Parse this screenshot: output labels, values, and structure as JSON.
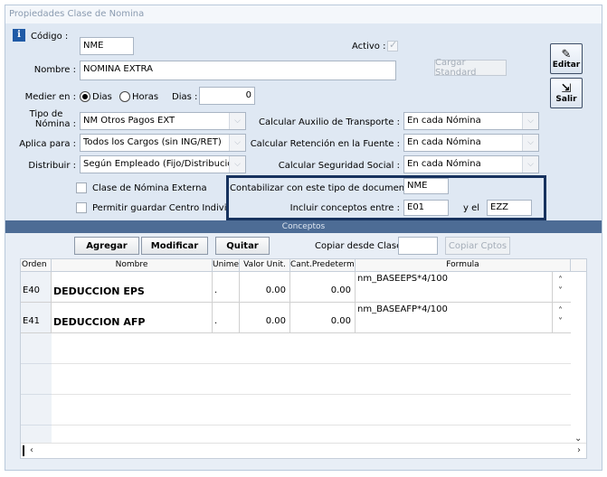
{
  "window": {
    "title": "Propiedades Clase de Nomina"
  },
  "form": {
    "codigo_label": "Código :",
    "codigo_value": "NME",
    "activo_label": "Activo :",
    "nombre_label": "Nombre :",
    "nombre_value": "NOMINA EXTRA",
    "cargar_standard": "Cargar Standard",
    "medier_label": "Medier en :",
    "radio_dias": "Dias",
    "radio_horas": "Horas",
    "dias_label": "Dias :",
    "dias_value": "0",
    "tipo_nomina_label_1": "Tipo de",
    "tipo_nomina_label_2": "Nómina :",
    "tipo_nomina_value": "NM Otros Pagos EXT",
    "aplica_label": "Aplica para :",
    "aplica_value": "Todos los Cargos (sin ING/RET)",
    "distribuir_label": "Distribuir :",
    "distribuir_value": "Según Empleado (Fijo/Distribución)",
    "auxilio_label": "Calcular Auxilio de Transporte :",
    "auxilio_value": "En cada Nómina",
    "retencion_label": "Calcular Retención en la Fuente :",
    "retencion_value": "En cada Nómina",
    "seguridad_label": "Calcular Seguridad Social :",
    "seguridad_value": "En cada Nómina",
    "externa_label": "Clase de Nómina Externa",
    "centro_label": "Permitir guardar Centro Individual",
    "contabilizar_label": "Contabilizar con este tipo de documento :",
    "contabilizar_value": "NME",
    "incluir_label": "Incluir conceptos entre :",
    "incluir_from": "E01",
    "yel_label": "y el",
    "incluir_to": "EZZ"
  },
  "side": {
    "editar": "Editar",
    "salir": "Salir"
  },
  "conceptos": {
    "section_title": "Conceptos",
    "agregar": "Agregar",
    "modificar": "Modificar",
    "quitar": "Quitar",
    "copiar_label": "Copiar desde Clase :",
    "copiar_value": "",
    "copiar_btn": "Copiar Cptos",
    "columns": [
      "Orden",
      "Nombre",
      "Unimec",
      "Valor Unit.",
      "Cant.Predetermi",
      "Formula"
    ],
    "rows": [
      {
        "orden": "E40",
        "nombre": "DEDUCCION EPS",
        "unimed": ".",
        "valor": "0.00",
        "cant": "0.00",
        "formula": "nm_BASEEPS*4/100"
      },
      {
        "orden": "E41",
        "nombre": "DEDUCCION AFP",
        "unimed": ".",
        "valor": "0.00",
        "cant": "0.00",
        "formula": "nm_BASEAFP*4/100"
      }
    ]
  }
}
